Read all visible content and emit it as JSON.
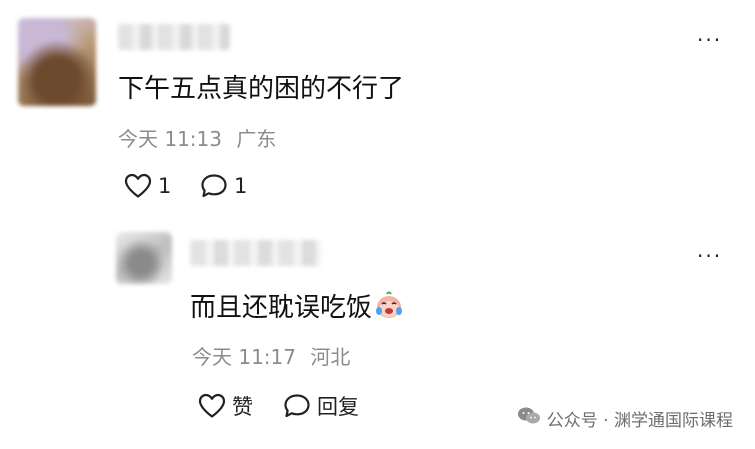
{
  "main_comment": {
    "text": "下午五点真的困的不行了",
    "time": "今天 11:13",
    "location": "广东",
    "like_count": "1",
    "reply_count": "1",
    "more_label": "···"
  },
  "reply_comment": {
    "text": "而且还耽误吃饭",
    "emoji": "crying-face-emoji",
    "time": "今天 11:17",
    "location": "河北",
    "like_label": "赞",
    "reply_label": "回复",
    "more_label": "···"
  },
  "watermark": {
    "text": "公众号 · 渊学通国际课程"
  },
  "icons": {
    "like": "heart-icon",
    "comment": "comment-bubble-icon",
    "more": "more-dots-icon",
    "wechat": "wechat-icon"
  }
}
